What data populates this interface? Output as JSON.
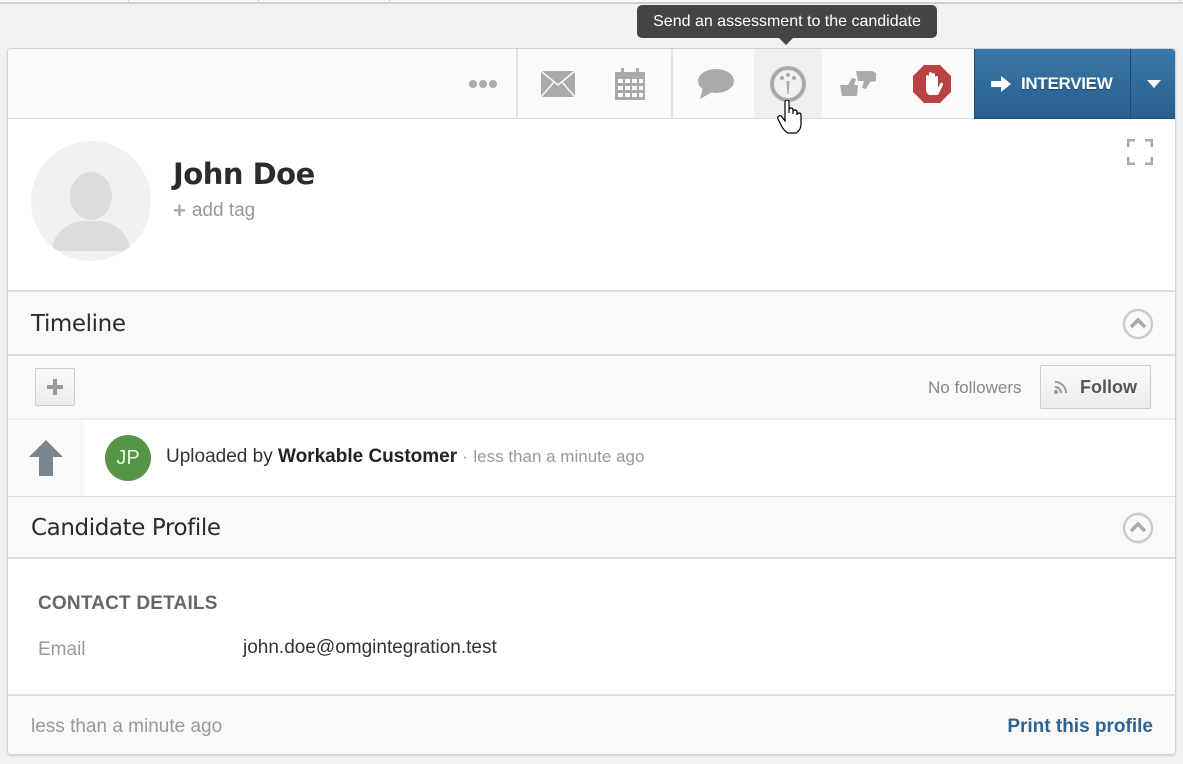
{
  "tooltip": {
    "text": "Send an assessment to the candidate"
  },
  "toolbar": {
    "buttons": [
      {
        "id": "more",
        "icon": "ellipsis-icon",
        "label": "More actions"
      },
      {
        "id": "email",
        "icon": "envelope-icon",
        "label": "Email"
      },
      {
        "id": "schedule",
        "icon": "calendar-icon",
        "label": "Schedule"
      },
      {
        "id": "comment",
        "icon": "speech-bubble-icon",
        "label": "Comment"
      },
      {
        "id": "assessment",
        "icon": "assessment-gauge-icon",
        "label": "Send an assessment to the candidate"
      },
      {
        "id": "evaluate",
        "icon": "thumbs-up-down-icon",
        "label": "Evaluate"
      },
      {
        "id": "disqualify",
        "icon": "stop-hand-icon",
        "label": "Disqualify"
      }
    ],
    "primary_action": {
      "label": "INTERVIEW",
      "icon": "arrow-right-icon"
    },
    "colors": {
      "primary": "#2f6a9a",
      "disqualify": "#b94244"
    }
  },
  "candidate": {
    "name": "John Doe",
    "add_tag_label": "add tag"
  },
  "timeline": {
    "title": "Timeline",
    "followers_text": "No followers",
    "follow_label": "Follow",
    "items": [
      {
        "icon": "upload-arrow-icon",
        "avatar_initials": "JP",
        "avatar_color": "#559547",
        "prefix": "Uploaded by",
        "actor": "Workable Customer",
        "separator": "·",
        "time": "less than a minute ago"
      }
    ]
  },
  "profile": {
    "title": "Candidate Profile",
    "contact_heading": "CONTACT DETAILS",
    "fields": [
      {
        "label": "Email",
        "value": "john.doe@omgintegration.test"
      }
    ]
  },
  "footer": {
    "time": "less than a minute ago",
    "print_label": "Print this profile"
  }
}
